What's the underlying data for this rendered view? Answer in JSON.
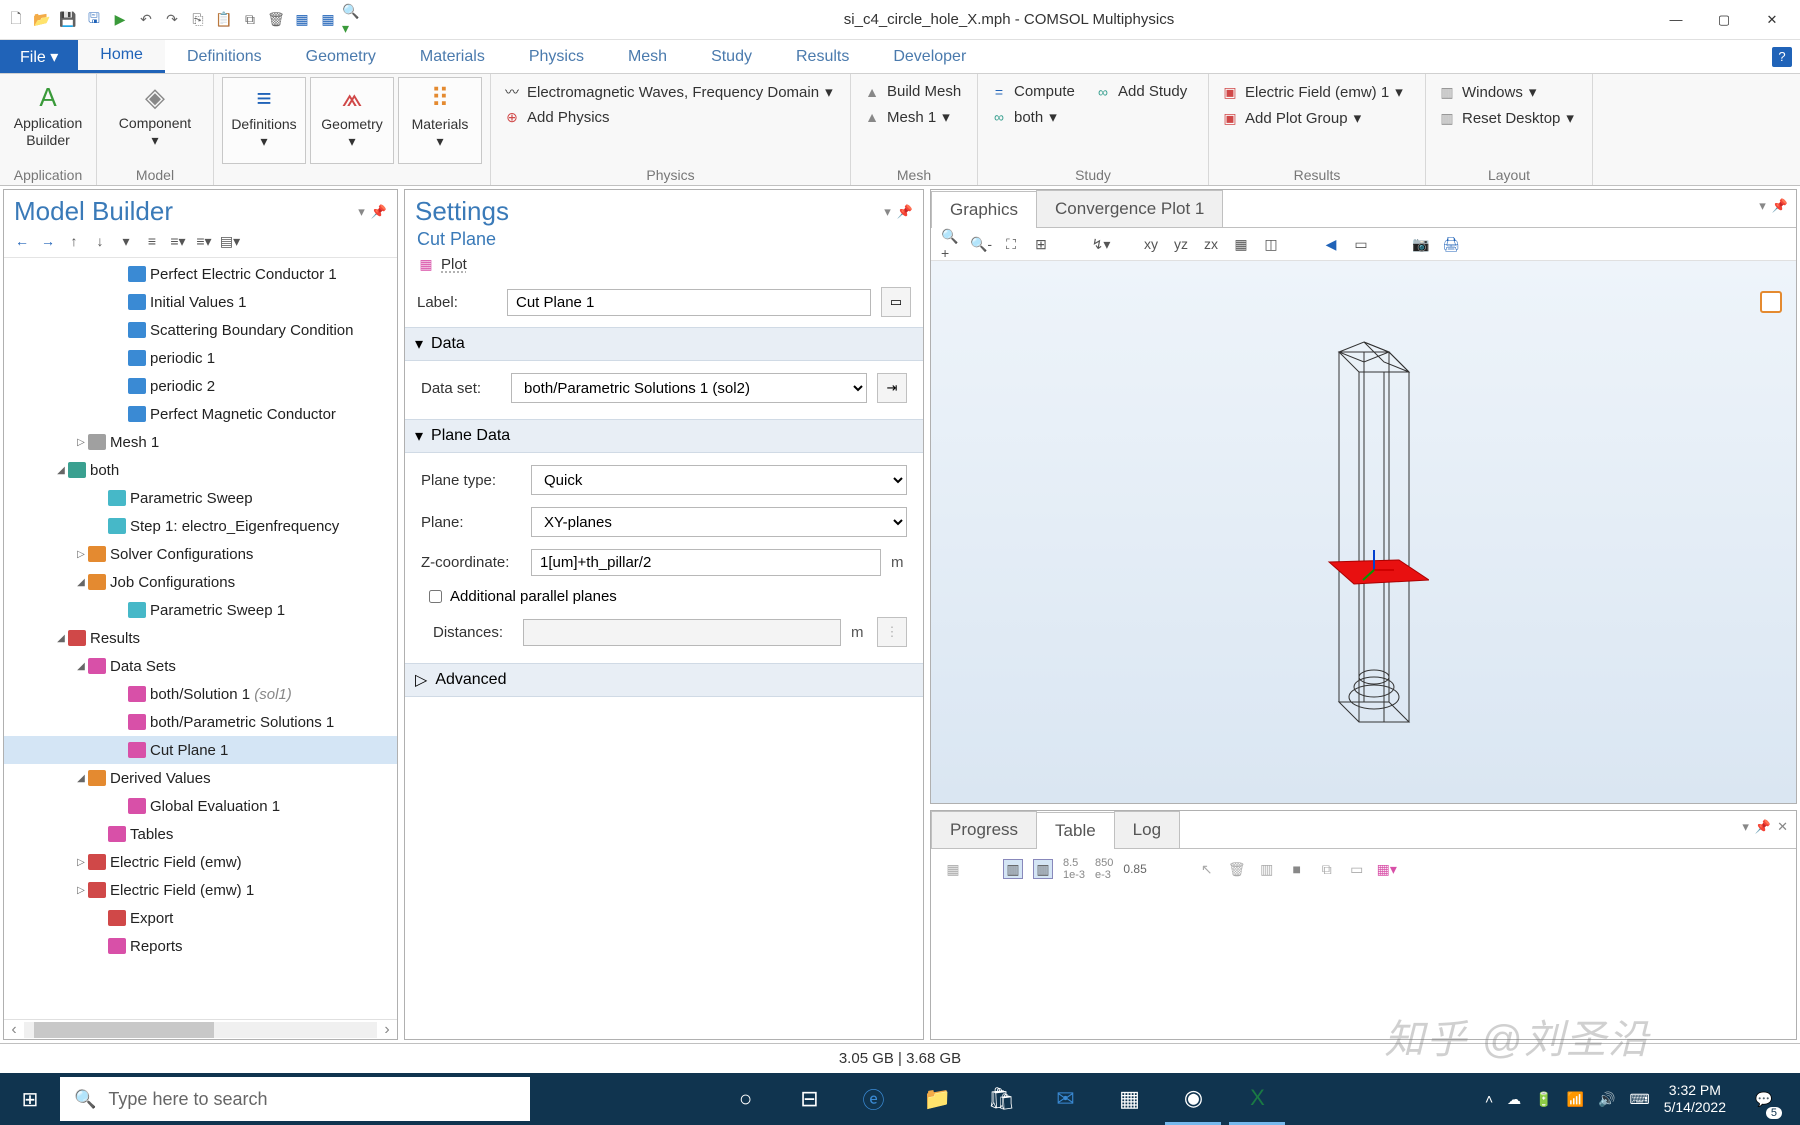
{
  "title": "si_c4_circle_hole_X.mph - COMSOL Multiphysics",
  "file_tab": "File ▾",
  "tabs": [
    "Home",
    "Definitions",
    "Geometry",
    "Materials",
    "Physics",
    "Mesh",
    "Study",
    "Results",
    "Developer"
  ],
  "active_tab": "Home",
  "ribbon": {
    "appbuilder": "Application\nBuilder",
    "application_grp": "Application",
    "component": "Component",
    "model_grp": "Model",
    "definitions": "Definitions",
    "geometry": "Geometry",
    "materials": "Materials",
    "physics_grp": "Physics",
    "emw": "Electromagnetic Waves, Frequency Domain",
    "addphys": "Add Physics",
    "mesh_grp": "Mesh",
    "buildmesh": "Build Mesh",
    "mesh1": "Mesh 1",
    "study_grp": "Study",
    "compute": "Compute",
    "addstudy": "Add Study",
    "both": "both",
    "results_grp": "Results",
    "efield": "Electric Field (emw) 1",
    "addplot": "Add Plot Group",
    "layout_grp": "Layout",
    "windows": "Windows",
    "reset": "Reset Desktop"
  },
  "mb": {
    "title": "Model Builder",
    "tree": [
      {
        "indent": 110,
        "ico": "i-blue",
        "label": "Perfect Electric Conductor 1"
      },
      {
        "indent": 110,
        "ico": "i-blue",
        "label": "Initial Values 1"
      },
      {
        "indent": 110,
        "ico": "i-blue",
        "label": "Scattering Boundary Condition"
      },
      {
        "indent": 110,
        "ico": "i-blue",
        "label": "periodic 1"
      },
      {
        "indent": 110,
        "ico": "i-blue",
        "label": "periodic 2"
      },
      {
        "indent": 110,
        "ico": "i-blue",
        "label": "Perfect Magnetic Conductor"
      },
      {
        "indent": 70,
        "caret": "▷",
        "ico": "i-gray",
        "label": "Mesh 1"
      },
      {
        "indent": 50,
        "caret": "◢",
        "ico": "i-teal",
        "label": "both"
      },
      {
        "indent": 90,
        "ico": "i-cyan",
        "label": "Parametric Sweep"
      },
      {
        "indent": 90,
        "ico": "i-cyan",
        "label": "Step 1: electro_Eigenfrequency"
      },
      {
        "indent": 70,
        "caret": "▷",
        "ico": "i-orange",
        "label": "Solver Configurations"
      },
      {
        "indent": 70,
        "caret": "◢",
        "ico": "i-orange",
        "label": "Job Configurations"
      },
      {
        "indent": 110,
        "ico": "i-cyan",
        "label": "Parametric Sweep 1"
      },
      {
        "indent": 50,
        "caret": "◢",
        "ico": "i-red",
        "label": "Results"
      },
      {
        "indent": 70,
        "caret": "◢",
        "ico": "i-pink",
        "label": "Data Sets"
      },
      {
        "indent": 110,
        "ico": "i-pink",
        "label": "both/Solution 1 ",
        "hint": "(sol1)"
      },
      {
        "indent": 110,
        "ico": "i-pink",
        "label": "both/Parametric Solutions 1"
      },
      {
        "indent": 110,
        "ico": "i-pink",
        "label": "Cut Plane 1",
        "selected": true
      },
      {
        "indent": 70,
        "caret": "◢",
        "ico": "i-orange",
        "label": "Derived Values"
      },
      {
        "indent": 110,
        "ico": "i-pink",
        "label": "Global Evaluation 1"
      },
      {
        "indent": 90,
        "ico": "i-pink",
        "label": "Tables"
      },
      {
        "indent": 70,
        "caret": "▷",
        "ico": "i-red",
        "label": "Electric Field (emw)"
      },
      {
        "indent": 70,
        "caret": "▷",
        "ico": "i-red",
        "label": "Electric Field (emw) 1"
      },
      {
        "indent": 90,
        "ico": "i-red",
        "label": "Export"
      },
      {
        "indent": 90,
        "ico": "i-pink",
        "label": "Reports"
      }
    ]
  },
  "settings": {
    "title": "Settings",
    "subtitle": "Cut Plane",
    "plot_action": "Plot",
    "label_lbl": "Label:",
    "label_val": "Cut Plane 1",
    "section_data": "Data",
    "dataset_lbl": "Data set:",
    "dataset_val": "both/Parametric Solutions 1 (sol2)",
    "section_plane": "Plane Data",
    "planetype_lbl": "Plane type:",
    "planetype_val": "Quick",
    "plane_lbl": "Plane:",
    "plane_val": "XY-planes",
    "zcoord_lbl": "Z-coordinate:",
    "zcoord_val": "1[um]+th_pillar/2",
    "zcoord_unit": "m",
    "addpar": "Additional parallel planes",
    "dist_lbl": "Distances:",
    "dist_unit": "m",
    "section_adv": "Advanced"
  },
  "gfx": {
    "tab1": "Graphics",
    "tab2": "Convergence Plot 1"
  },
  "bottom": {
    "tab1": "Progress",
    "tab2": "Table",
    "tab3": "Log",
    "val1": "8.5\n1e-3",
    "val2": "850\ne-3",
    "val3": "0.85"
  },
  "status": "3.05 GB | 3.68 GB",
  "taskbar": {
    "search_ph": "Type here to search",
    "time": "3:32 PM",
    "date": "5/14/2022",
    "notif_count": "5"
  },
  "watermark": "知乎 @刘圣沿"
}
